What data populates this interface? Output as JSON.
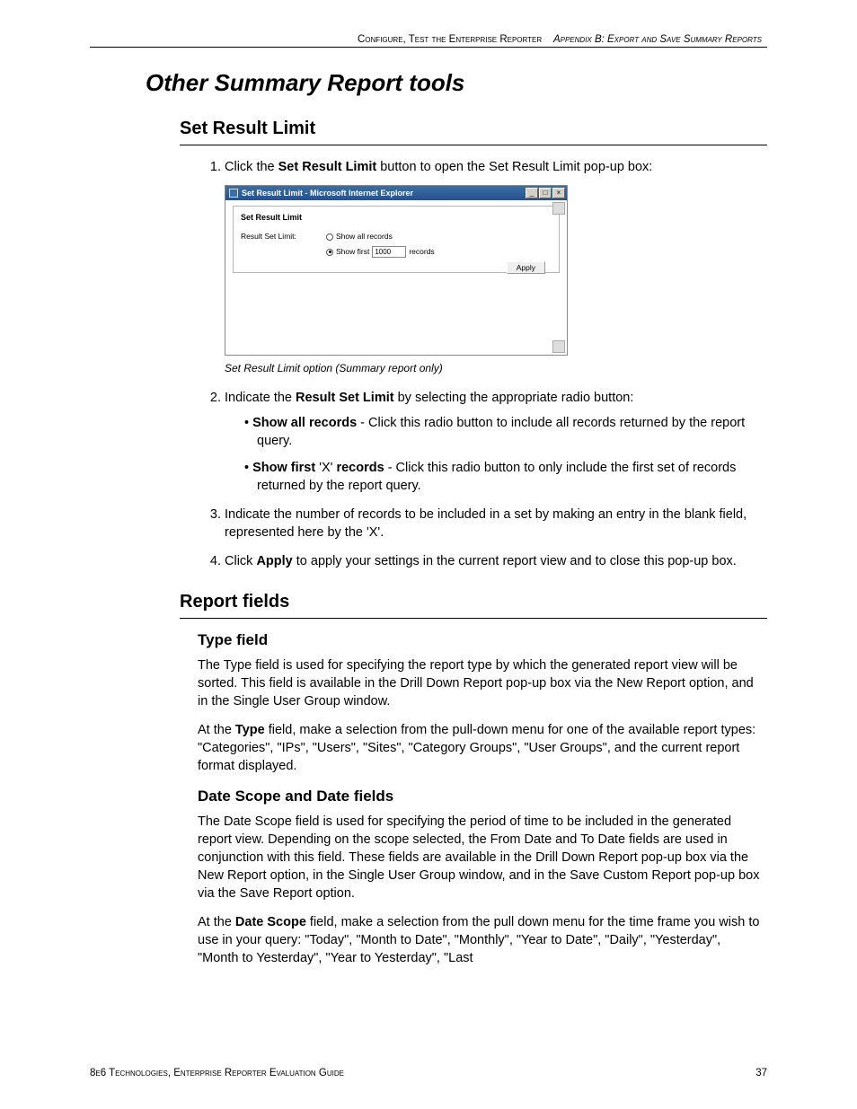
{
  "header": {
    "left": "Configure, Test the Enterprise Reporter",
    "right": "Appendix B: Export and Save Summary Reports"
  },
  "page_title": "Other Summary Report tools",
  "section1": {
    "heading": "Set Result Limit",
    "step1_pre": "Click the ",
    "step1_bold": "Set Result Limit",
    "step1_post": " button to open the Set Result Limit pop-up box:",
    "caption": "Set Result Limit option (Summary report only)",
    "step2_pre": "Indicate the ",
    "step2_bold": "Result Set Limit",
    "step2_post": " by selecting the appropriate radio button:",
    "bullet1_b": "Show all records",
    "bullet1_rest": " - Click this radio button to include all records returned by the report query.",
    "bullet2_b1": "Show first",
    "bullet2_mid": " 'X' ",
    "bullet2_b2": "records",
    "bullet2_rest": " - Click this radio button to only include the first set of records returned by the report query.",
    "step3": "Indicate the number of records to be included in a set by making an entry in the blank field, represented here by the 'X'.",
    "step4_pre": "Click ",
    "step4_bold": "Apply",
    "step4_post": " to apply your settings in the current report view and to close this pop-up box."
  },
  "figure": {
    "title": "Set Result Limit - Microsoft Internet Explorer",
    "panel_title": "Set Result Limit",
    "label": "Result Set Limit:",
    "opt_all": "Show all records",
    "opt_first_pre": "Show first",
    "opt_first_value": "1000",
    "opt_first_post": "records",
    "apply": "Apply"
  },
  "section2": {
    "heading": "Report fields",
    "sub1": "Type field",
    "p1": "The Type field is used for specifying the report type by which the generated report view will be sorted. This field is available in the Drill Down Report pop-up box via the New Report option, and in the Single User Group window.",
    "p2_pre": "At the ",
    "p2_bold": "Type",
    "p2_post": " field, make a selection from the pull-down menu for one of the available report types: \"Categories\", \"IPs\", \"Users\", \"Sites\", \"Category Groups\", \"User Groups\", and the current report format displayed.",
    "sub2": "Date Scope and Date fields",
    "p3": "The Date Scope field is used for specifying the period of time to be included in the generated report view. Depending on the scope selected, the From Date and To Date fields are used in conjunction with this field. These fields are available in the Drill Down Report pop-up box via the New Report option, in the Single User Group window, and in the Save Custom Report pop-up box via the Save Report option.",
    "p4_pre": "At the ",
    "p4_bold": "Date Scope",
    "p4_post": " field, make a selection from the pull down menu for the time frame you wish to use in your query:  \"Today\", \"Month to Date\", \"Monthly\", \"Year to Date\", \"Daily\", \"Yesterday\", \"Month to Yesterday\", \"Year to Yesterday\", \"Last"
  },
  "footer": {
    "left": "8e6 Technologies, Enterprise Reporter  Evaluation Guide",
    "page": "37"
  }
}
